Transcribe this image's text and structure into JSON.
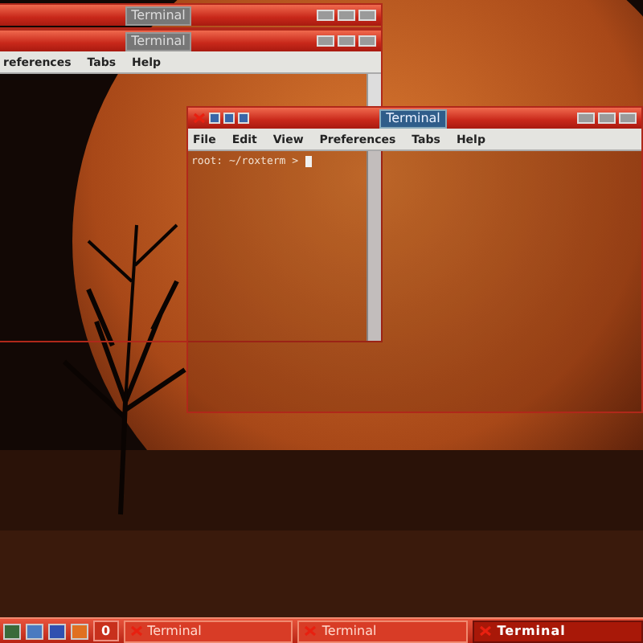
{
  "windows": [
    {
      "title": "Terminal",
      "active": false
    },
    {
      "title": "Terminal",
      "active": false,
      "menu": [
        {
          "label": "references"
        },
        {
          "label": "Tabs"
        },
        {
          "label": "Help"
        }
      ]
    },
    {
      "title": "Terminal",
      "active": true,
      "menu": [
        {
          "label": "File"
        },
        {
          "label": "Edit"
        },
        {
          "label": "View"
        },
        {
          "label": "Preferences"
        },
        {
          "label": "Tabs"
        },
        {
          "label": "Help"
        }
      ],
      "prompt": "root: ~/roxterm >"
    }
  ],
  "taskbar": {
    "workspace": "0",
    "tasks": [
      {
        "label": "Terminal",
        "selected": false
      },
      {
        "label": "Terminal",
        "selected": false
      },
      {
        "label": "Terminal",
        "selected": true
      }
    ]
  }
}
